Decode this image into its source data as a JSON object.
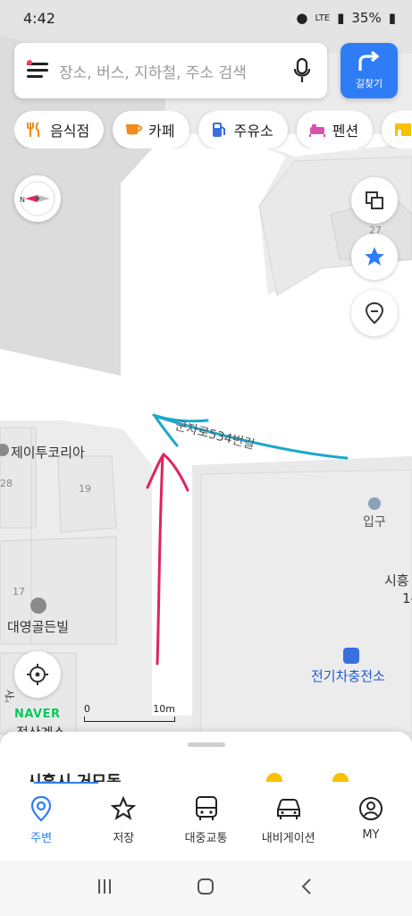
{
  "status_bar": {
    "time": "4:42",
    "network": "LTE",
    "battery": "35%"
  },
  "search": {
    "placeholder": "장소, 버스, 지하철, 주소 검색"
  },
  "directions_button": {
    "label": "길찾기"
  },
  "categories": [
    {
      "label": "음식점",
      "icon": "fork-knife-icon",
      "color": "#f28a1c"
    },
    {
      "label": "카페",
      "icon": "coffee-cup-icon",
      "color": "#f28a1c"
    },
    {
      "label": "주유소",
      "icon": "fuel-pump-icon",
      "color": "#3b6fe0"
    },
    {
      "label": "펜션",
      "icon": "bed-icon",
      "color": "#d653b0"
    }
  ],
  "map": {
    "road_label": "군자로534번길",
    "places": [
      {
        "name": "제이투코리아"
      },
      {
        "name": "대영골든빌"
      },
      {
        "name": "입구"
      },
      {
        "name": "전기차충전소"
      },
      {
        "name": "정산계소"
      },
      {
        "name": "시흥"
      }
    ],
    "building_numbers": [
      "27",
      "28",
      "19",
      "17",
      "1"
    ],
    "side_labels": [
      "1-",
      "사"
    ],
    "scale": {
      "min": "0",
      "max": "10m"
    },
    "brand": "NAVER",
    "annotation_colors": {
      "arrow_up": "#e0245e",
      "arrow_left": "#1aa9c9"
    }
  },
  "bottom_sheet": {
    "title": "시흥시 거모동"
  },
  "tabs": [
    {
      "label": "주변",
      "icon": "location-pin-icon",
      "active": true
    },
    {
      "label": "저장",
      "icon": "star-outline-icon",
      "active": false
    },
    {
      "label": "대중교통",
      "icon": "bus-icon",
      "active": false
    },
    {
      "label": "내비게이션",
      "icon": "car-icon",
      "active": false
    },
    {
      "label": "MY",
      "icon": "user-icon",
      "active": false
    }
  ],
  "colors": {
    "accent": "#2f7df6",
    "brand_green": "#02c75a"
  }
}
